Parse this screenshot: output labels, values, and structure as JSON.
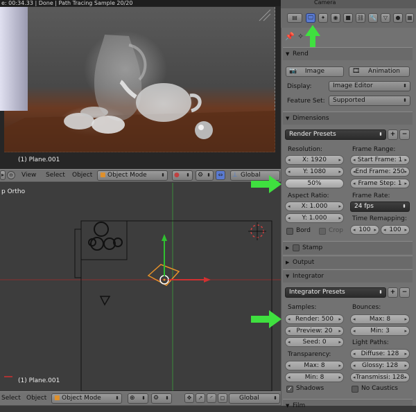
{
  "render": {
    "header_text": "e: 00:34.33 | Done | Path Tracing Sample 20/20",
    "object_label": "(1) Plane.001"
  },
  "view_toolbar": {
    "menu_view": "View",
    "menu_select": "Select",
    "menu_object": "Object",
    "mode": "Object Mode",
    "orientation": "Global"
  },
  "viewport": {
    "view_label": "p Ortho",
    "object_label": "(1) Plane.001"
  },
  "bottom_toolbar": {
    "menu_select": "Select",
    "menu_object": "Object",
    "mode": "Object Mode",
    "orientation": "Global"
  },
  "properties": {
    "header_title": "Camera",
    "render_section": {
      "title": "Rend",
      "image_button": "Image",
      "animation_button": "Animation",
      "display_label": "Display:",
      "display_value": "Image Editor",
      "feature_set_label": "Feature Set:",
      "feature_set_value": "Supported"
    },
    "dimensions": {
      "title": "Dimensions",
      "presets": "Render Presets",
      "resolution_label": "Resolution:",
      "res_x": "X: 1920",
      "res_y": "Y: 1080",
      "res_pct": "50%",
      "frame_range_label": "Frame Range:",
      "start_frame": "Start Frame: 1",
      "end_frame": "End Frame: 250",
      "frame_step": "Frame Step: 1",
      "aspect_label": "Aspect Ratio:",
      "aspect_x": "X: 1.000",
      "aspect_y": "Y: 1.000",
      "frame_rate_label": "Frame Rate:",
      "frame_rate": "24 fps",
      "bord_label": "Bord",
      "crop_label": "Crop",
      "time_remap_label": "Time Remapping:",
      "remap_old": "100",
      "remap_new": "100"
    },
    "stamp_title": "Stamp",
    "output_title": "Output",
    "integrator": {
      "title": "Integrator",
      "presets": "Integrator Presets",
      "samples_label": "Samples:",
      "render_samples": "Render: 500",
      "preview_samples": "Preview: 20",
      "seed": "Seed: 0",
      "bounces_label": "Bounces:",
      "bounce_max": "Max: 8",
      "bounce_min": "Min: 3",
      "light_paths_label": "Light Paths:",
      "diffuse": "Diffuse: 128",
      "glossy": "Glossy: 128",
      "transmission": "Transmissi: 128",
      "transparency_label": "Transparency:",
      "trans_max": "Max: 8",
      "trans_min": "Min: 8",
      "shadows_label": "Shadows",
      "no_caustics_label": "No Caustics"
    },
    "film_title": "Film"
  },
  "colors": {
    "highlight_arrow": "#3fe03f",
    "selection_orange": "#e8922a",
    "axis_red": "#d03030",
    "axis_green": "#30c030"
  }
}
